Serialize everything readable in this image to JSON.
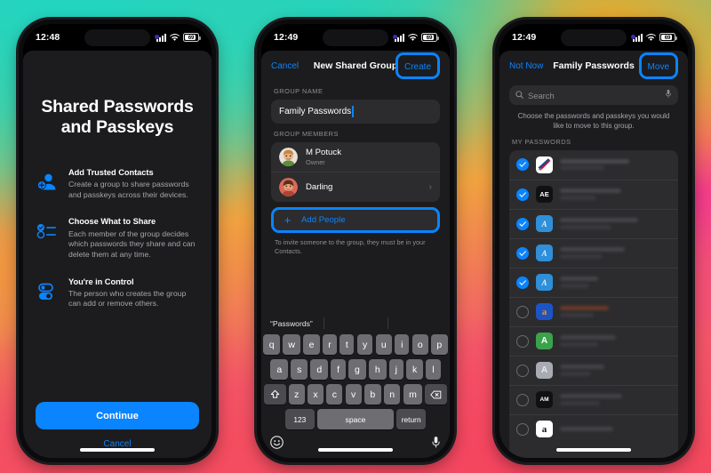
{
  "accent": "#0a84ff",
  "phones": [
    {
      "id": "phone-intro",
      "status": {
        "time": "12:48",
        "battery": "69"
      },
      "intro": {
        "title": "Shared Passwords and Passkeys",
        "features": [
          {
            "icon": "person-badge-plus-icon",
            "heading": "Add Trusted Contacts",
            "body": "Create a group to share passwords and passkeys across their devices."
          },
          {
            "icon": "checklist-icon",
            "heading": "Choose What to Share",
            "body": "Each member of the group decides which passwords they share and can delete them at any time."
          },
          {
            "icon": "toggles-icon",
            "heading": "You're in Control",
            "body": "The person who creates the group can add or remove others."
          }
        ],
        "continue_label": "Continue",
        "cancel_label": "Cancel"
      }
    },
    {
      "id": "phone-new-group",
      "status": {
        "time": "12:49",
        "battery": "69"
      },
      "nav": {
        "left": "Cancel",
        "title": "New Shared Group",
        "right": "Create",
        "right_highlighted": true
      },
      "group_name": {
        "label": "GROUP NAME",
        "value": "Family Passwords"
      },
      "members": {
        "label": "GROUP MEMBERS",
        "rows": [
          {
            "name": "M Potuck",
            "sub": "Owner",
            "chevron": false
          },
          {
            "name": "Darling",
            "sub": "",
            "chevron": true
          }
        ],
        "add_label": "Add People",
        "add_highlighted": true,
        "hint": "To invite someone to the group, they must be in your Contacts."
      },
      "keyboard": {
        "suggestion": "“Passwords”",
        "row1": [
          "q",
          "w",
          "e",
          "r",
          "t",
          "y",
          "u",
          "i",
          "o",
          "p"
        ],
        "row2": [
          "a",
          "s",
          "d",
          "f",
          "g",
          "h",
          "j",
          "k",
          "l"
        ],
        "row3": [
          "z",
          "x",
          "c",
          "v",
          "b",
          "n",
          "m"
        ],
        "shift_icon": "shift-icon",
        "backspace_icon": "backspace-icon",
        "numeric_label": "123",
        "space_label": "space",
        "return_label": "return",
        "emoji_icon": "emoji-icon",
        "mic_icon": "microphone-icon"
      }
    },
    {
      "id": "phone-move-passwords",
      "status": {
        "time": "12:49",
        "battery": "69"
      },
      "nav": {
        "left": "Not Now",
        "title": "Family Passwords",
        "right": "Move",
        "right_highlighted": true
      },
      "search": {
        "placeholder": "Search",
        "icon": "search-icon",
        "mic_icon": "microphone-icon"
      },
      "instruction": "Choose the passwords and passkeys you would like to move to this group.",
      "list_label": "MY PASSWORDS",
      "rows": [
        {
          "selected": true,
          "icon_kind": "airline",
          "icon_text": "",
          "icon_bg": "#ffffff",
          "icon_fg": "#c8102e"
        },
        {
          "selected": true,
          "icon_kind": "mono",
          "icon_text": "AE",
          "icon_bg": "#111114",
          "icon_fg": "#ffffff"
        },
        {
          "selected": true,
          "icon_kind": "script",
          "icon_text": "A",
          "icon_bg": "#2f8fd8",
          "icon_fg": "#dceaf7"
        },
        {
          "selected": true,
          "icon_kind": "script",
          "icon_text": "A",
          "icon_bg": "#2f8fd8",
          "icon_fg": "#dceaf7"
        },
        {
          "selected": true,
          "icon_kind": "script",
          "icon_text": "A",
          "icon_bg": "#2f8fd8",
          "icon_fg": "#dceaf7"
        },
        {
          "selected": false,
          "icon_kind": "mono",
          "icon_text": "a",
          "icon_bg": "#1b54c4",
          "icon_fg": "#ff8c1a"
        },
        {
          "selected": false,
          "icon_kind": "mono",
          "icon_text": "A",
          "icon_bg": "#3aa34a",
          "icon_fg": "#ffffff"
        },
        {
          "selected": false,
          "icon_kind": "mono",
          "icon_text": "A",
          "icon_bg": "#a9abb3",
          "icon_fg": "#e8e8ed"
        },
        {
          "selected": false,
          "icon_kind": "mono",
          "icon_text": "AM",
          "icon_bg": "#111114",
          "icon_fg": "#ffffff"
        },
        {
          "selected": false,
          "icon_kind": "mono",
          "icon_text": "a",
          "icon_bg": "#ffffff",
          "icon_fg": "#111114"
        }
      ]
    }
  ]
}
